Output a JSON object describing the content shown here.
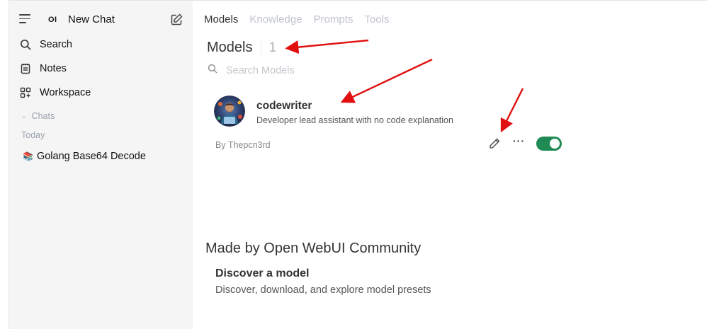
{
  "sidebar": {
    "logo_text": "OI",
    "new_chat_label": "New Chat",
    "items": [
      {
        "label": "Search",
        "icon": "search-icon"
      },
      {
        "label": "Notes",
        "icon": "notes-icon"
      },
      {
        "label": "Workspace",
        "icon": "workspace-icon"
      }
    ],
    "chats_label": "Chats",
    "today_label": "Today",
    "chat_history": [
      {
        "emoji": "📚",
        "title": "Golang Base64 Decode"
      }
    ]
  },
  "tabs": [
    {
      "label": "Models",
      "active": true
    },
    {
      "label": "Knowledge",
      "active": false
    },
    {
      "label": "Prompts",
      "active": false
    },
    {
      "label": "Tools",
      "active": false
    }
  ],
  "models_section": {
    "title": "Models",
    "count": "1",
    "search_placeholder": "Search Models"
  },
  "model": {
    "name": "codewriter",
    "description": "Developer lead assistant with no code explanation",
    "author": "By Thepcn3rd",
    "enabled": true
  },
  "community": {
    "title": "Made by Open WebUI Community",
    "discover_title": "Discover a model",
    "discover_description": "Discover, download, and explore model presets"
  },
  "colors": {
    "sidebar_bg": "#f5f5f5",
    "toggle_on": "#1f8a54",
    "annotation_arrow": "#e01010"
  }
}
